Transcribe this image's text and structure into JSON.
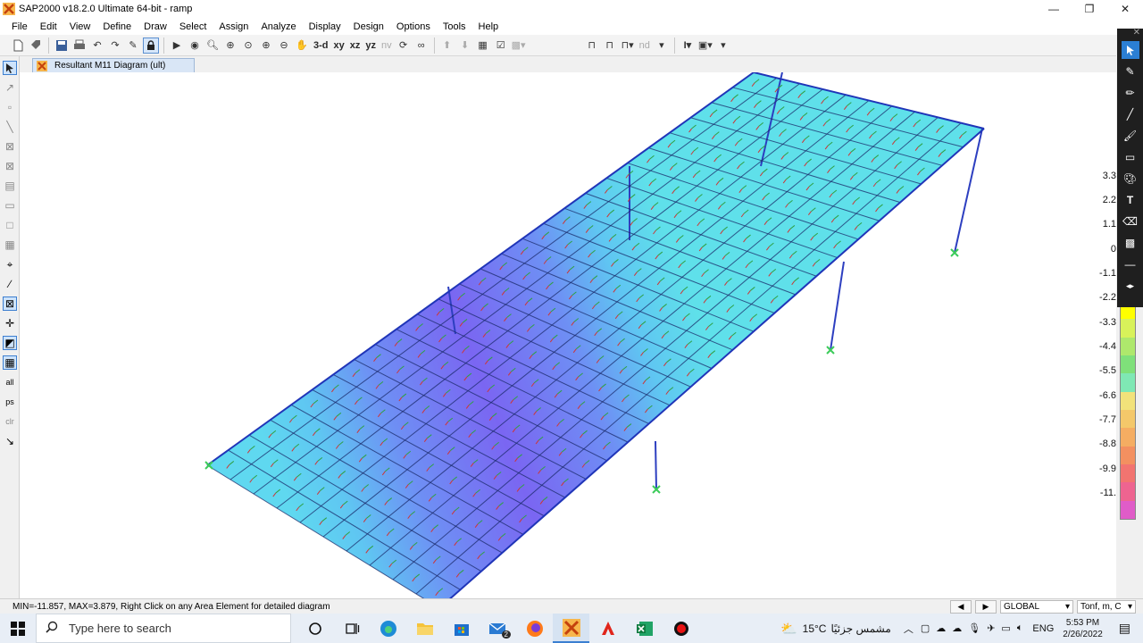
{
  "window": {
    "title": "SAP2000 v18.2.0 Ultimate 64-bit - ramp",
    "minimize_glyph": "—",
    "maximize_glyph": "❐",
    "close_glyph": "✕"
  },
  "menu": [
    "File",
    "Edit",
    "View",
    "Define",
    "Draw",
    "Select",
    "Assign",
    "Analyze",
    "Display",
    "Design",
    "Options",
    "Tools",
    "Help"
  ],
  "toolbar": {
    "view_3d": "3-d",
    "view_xy": "xy",
    "view_xz": "xz",
    "view_yz": "yz",
    "view_nv": "nv",
    "nd_label": "nd"
  },
  "tab": {
    "label": "Resultant M11 Diagram   (ult)"
  },
  "scale": {
    "labels": [
      "3.3",
      "2.2",
      "1.1",
      "0",
      "-1.1",
      "-2.2",
      "-3.3",
      "-4.4",
      "-5.5",
      "-6.6",
      "-7.7",
      "-8.8",
      "-9.9",
      "-11."
    ],
    "colors": [
      "#ffff00",
      "#d8f25a",
      "#aee86c",
      "#7fe07a",
      "#7fe8b4",
      "#f2e27a",
      "#f4c86a",
      "#f5ad62",
      "#f39060",
      "#f27470",
      "#ee6490",
      "#e05cc8"
    ]
  },
  "status": {
    "message": "MIN=-11.857, MAX=3.879, Right Click on any Area Element for detailed diagram",
    "coord_system": "GLOBAL",
    "units": "Tonf, m, C"
  },
  "taskbar": {
    "search_placeholder": "Type here to search",
    "weather_temp": "15°C",
    "weather_text": "مشمس جزئيًا",
    "language": "ENG",
    "time": "5:53 PM",
    "date": "2/26/2022",
    "mail_badge": "2"
  }
}
